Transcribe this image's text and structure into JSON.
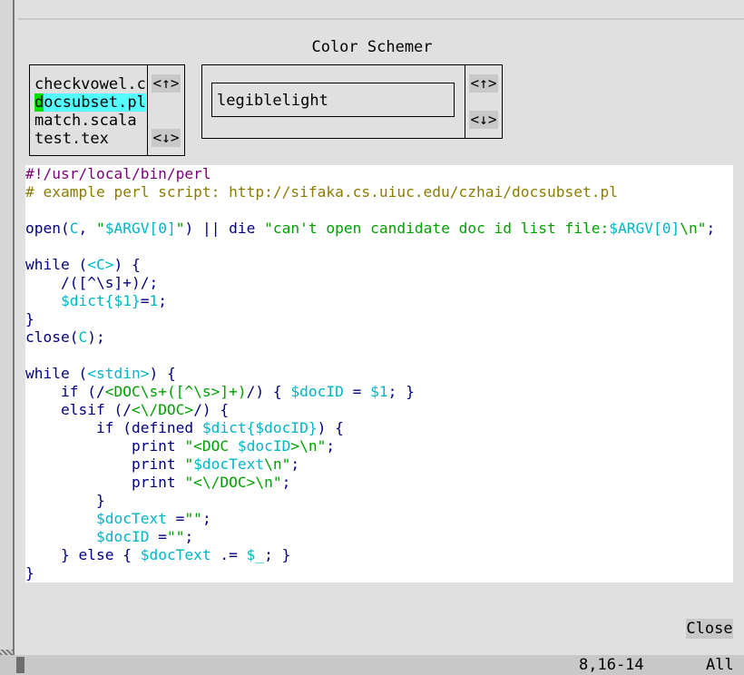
{
  "dialog": {
    "title": "Color Schemer",
    "close_label": "Close"
  },
  "files": {
    "items": [
      "checkvowel.c",
      "docsubset.pl",
      "match.scala",
      "test.tex"
    ],
    "selected_index": 1,
    "up_label": "<↑>",
    "down_label": "<↓>"
  },
  "schemes": {
    "current": "legiblelight",
    "up_label": "<↑>",
    "down_label": "<↓>"
  },
  "code": {
    "l1": "#!/usr/local/bin/perl",
    "l2": "# example perl script: http://sifaka.cs.uiuc.edu/czhai/docsubset.pl",
    "l4_open": "open(",
    "l4_C": "C",
    "l4_comma": ", ",
    "l4_str1": "\"",
    "l4_argv": "$ARGV[0]",
    "l4_str2": "\"",
    "l4_mid": ") || die ",
    "l4_str3": "\"can't open candidate doc id list file:",
    "l4_argv2": "$ARGV[0]",
    "l4_str4": "\\n\"",
    "l4_end": ";",
    "l6_while": "while (",
    "l6_fh": "<C>",
    "l6_end": ") {",
    "l7": "    /([^\\s]+)/;",
    "l8_indent": "    ",
    "l8_var": "$dict{$1}",
    "l8_eq": "=",
    "l8_num": "1",
    "l8_end": ";",
    "l9": "}",
    "l10_close": "close(",
    "l10_C": "C",
    "l10_end": ");",
    "l12_while": "while (",
    "l12_fh": "<stdin>",
    "l12_end": ") {",
    "l13_a": "    if (/",
    "l13_re": "<DOC\\s+([^\\s>]+)",
    "l13_b": "/) { ",
    "l13_var": "$docID",
    "l13_c": " = ",
    "l13_var2": "$1",
    "l13_d": "; }",
    "l14_a": "    elsif (/",
    "l14_re": "<\\/DOC>",
    "l14_b": "/) {",
    "l15_a": "        if (defined ",
    "l15_var": "$dict{$docID}",
    "l15_b": ") {",
    "l16_a": "            print ",
    "l16_s1": "\"<DOC ",
    "l16_var": "$docID",
    "l16_s2": ">\\n\"",
    "l16_b": ";",
    "l17_a": "            print ",
    "l17_s1": "\"",
    "l17_var": "$docText",
    "l17_s2": "\\n\"",
    "l17_b": ";",
    "l18_a": "            print ",
    "l18_s": "\"<\\/DOC>\\n\"",
    "l18_b": ";",
    "l19": "        }",
    "l20_indent": "        ",
    "l20_var": "$docText",
    "l20_eq": " =",
    "l20_s": "\"\"",
    "l20_b": ";",
    "l21_indent": "        ",
    "l21_var": "$docID",
    "l21_eq": " =",
    "l21_s": "\"\"",
    "l21_b": ";",
    "l22_a": "    } else { ",
    "l22_var": "$docText",
    "l22_b": " .= ",
    "l22_var2": "$_",
    "l22_c": "; }",
    "l23": "}"
  },
  "status": {
    "position": "8,16-14",
    "scroll": "All"
  }
}
